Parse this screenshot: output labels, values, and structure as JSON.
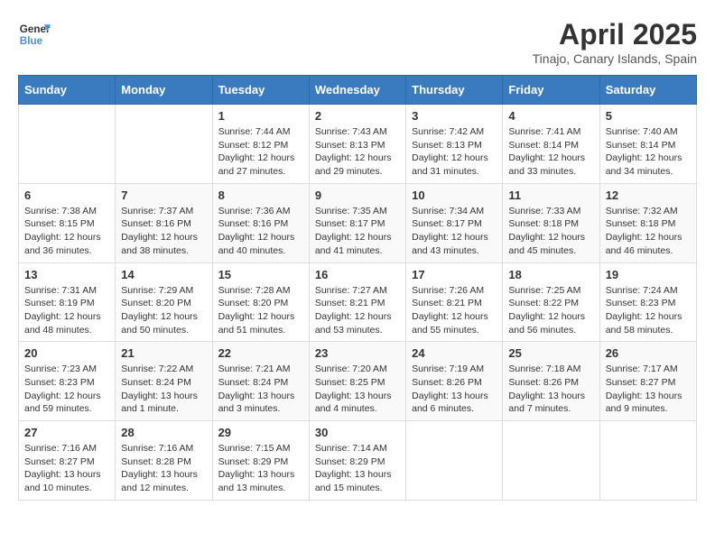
{
  "header": {
    "logo_general": "General",
    "logo_blue": "Blue",
    "title": "April 2025",
    "location": "Tinajo, Canary Islands, Spain"
  },
  "days_of_week": [
    "Sunday",
    "Monday",
    "Tuesday",
    "Wednesday",
    "Thursday",
    "Friday",
    "Saturday"
  ],
  "weeks": [
    [
      {
        "day": "",
        "info": ""
      },
      {
        "day": "",
        "info": ""
      },
      {
        "day": "1",
        "info": "Sunrise: 7:44 AM\nSunset: 8:12 PM\nDaylight: 12 hours and 27 minutes."
      },
      {
        "day": "2",
        "info": "Sunrise: 7:43 AM\nSunset: 8:13 PM\nDaylight: 12 hours and 29 minutes."
      },
      {
        "day": "3",
        "info": "Sunrise: 7:42 AM\nSunset: 8:13 PM\nDaylight: 12 hours and 31 minutes."
      },
      {
        "day": "4",
        "info": "Sunrise: 7:41 AM\nSunset: 8:14 PM\nDaylight: 12 hours and 33 minutes."
      },
      {
        "day": "5",
        "info": "Sunrise: 7:40 AM\nSunset: 8:14 PM\nDaylight: 12 hours and 34 minutes."
      }
    ],
    [
      {
        "day": "6",
        "info": "Sunrise: 7:38 AM\nSunset: 8:15 PM\nDaylight: 12 hours and 36 minutes."
      },
      {
        "day": "7",
        "info": "Sunrise: 7:37 AM\nSunset: 8:16 PM\nDaylight: 12 hours and 38 minutes."
      },
      {
        "day": "8",
        "info": "Sunrise: 7:36 AM\nSunset: 8:16 PM\nDaylight: 12 hours and 40 minutes."
      },
      {
        "day": "9",
        "info": "Sunrise: 7:35 AM\nSunset: 8:17 PM\nDaylight: 12 hours and 41 minutes."
      },
      {
        "day": "10",
        "info": "Sunrise: 7:34 AM\nSunset: 8:17 PM\nDaylight: 12 hours and 43 minutes."
      },
      {
        "day": "11",
        "info": "Sunrise: 7:33 AM\nSunset: 8:18 PM\nDaylight: 12 hours and 45 minutes."
      },
      {
        "day": "12",
        "info": "Sunrise: 7:32 AM\nSunset: 8:18 PM\nDaylight: 12 hours and 46 minutes."
      }
    ],
    [
      {
        "day": "13",
        "info": "Sunrise: 7:31 AM\nSunset: 8:19 PM\nDaylight: 12 hours and 48 minutes."
      },
      {
        "day": "14",
        "info": "Sunrise: 7:29 AM\nSunset: 8:20 PM\nDaylight: 12 hours and 50 minutes."
      },
      {
        "day": "15",
        "info": "Sunrise: 7:28 AM\nSunset: 8:20 PM\nDaylight: 12 hours and 51 minutes."
      },
      {
        "day": "16",
        "info": "Sunrise: 7:27 AM\nSunset: 8:21 PM\nDaylight: 12 hours and 53 minutes."
      },
      {
        "day": "17",
        "info": "Sunrise: 7:26 AM\nSunset: 8:21 PM\nDaylight: 12 hours and 55 minutes."
      },
      {
        "day": "18",
        "info": "Sunrise: 7:25 AM\nSunset: 8:22 PM\nDaylight: 12 hours and 56 minutes."
      },
      {
        "day": "19",
        "info": "Sunrise: 7:24 AM\nSunset: 8:23 PM\nDaylight: 12 hours and 58 minutes."
      }
    ],
    [
      {
        "day": "20",
        "info": "Sunrise: 7:23 AM\nSunset: 8:23 PM\nDaylight: 12 hours and 59 minutes."
      },
      {
        "day": "21",
        "info": "Sunrise: 7:22 AM\nSunset: 8:24 PM\nDaylight: 13 hours and 1 minute."
      },
      {
        "day": "22",
        "info": "Sunrise: 7:21 AM\nSunset: 8:24 PM\nDaylight: 13 hours and 3 minutes."
      },
      {
        "day": "23",
        "info": "Sunrise: 7:20 AM\nSunset: 8:25 PM\nDaylight: 13 hours and 4 minutes."
      },
      {
        "day": "24",
        "info": "Sunrise: 7:19 AM\nSunset: 8:26 PM\nDaylight: 13 hours and 6 minutes."
      },
      {
        "day": "25",
        "info": "Sunrise: 7:18 AM\nSunset: 8:26 PM\nDaylight: 13 hours and 7 minutes."
      },
      {
        "day": "26",
        "info": "Sunrise: 7:17 AM\nSunset: 8:27 PM\nDaylight: 13 hours and 9 minutes."
      }
    ],
    [
      {
        "day": "27",
        "info": "Sunrise: 7:16 AM\nSunset: 8:27 PM\nDaylight: 13 hours and 10 minutes."
      },
      {
        "day": "28",
        "info": "Sunrise: 7:16 AM\nSunset: 8:28 PM\nDaylight: 13 hours and 12 minutes."
      },
      {
        "day": "29",
        "info": "Sunrise: 7:15 AM\nSunset: 8:29 PM\nDaylight: 13 hours and 13 minutes."
      },
      {
        "day": "30",
        "info": "Sunrise: 7:14 AM\nSunset: 8:29 PM\nDaylight: 13 hours and 15 minutes."
      },
      {
        "day": "",
        "info": ""
      },
      {
        "day": "",
        "info": ""
      },
      {
        "day": "",
        "info": ""
      }
    ]
  ]
}
